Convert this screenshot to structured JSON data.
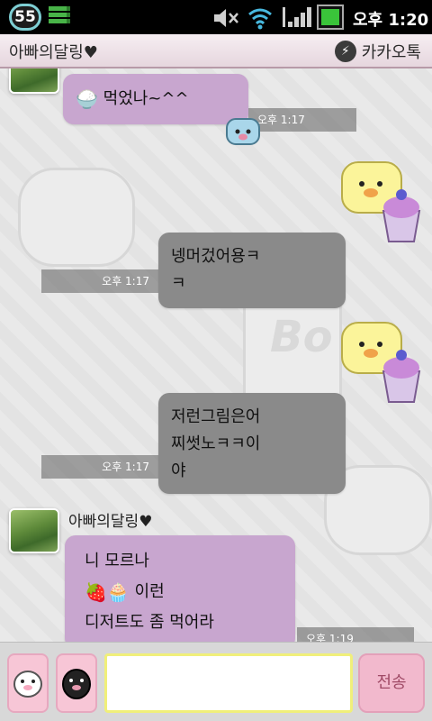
{
  "status_bar": {
    "notification_count": "55",
    "time": "오후 1:20",
    "icons": [
      "sd-card-icon",
      "mute-icon",
      "wifi-icon",
      "signal-icon",
      "battery-icon"
    ]
  },
  "header": {
    "title": "아빠의달링♥",
    "brand": "카카오톡",
    "brand_icon": "bolt-icon"
  },
  "messages": [
    {
      "side": "left",
      "text_lines": [
        "먹었나~^^"
      ],
      "leading_icon": "rice-bowl-icon",
      "time": "오후 1:17"
    },
    {
      "side": "right",
      "text_lines": [
        "넹머겄어용ㅋ",
        "ㅋ"
      ],
      "time": "오후 1:17"
    },
    {
      "side": "right",
      "text_lines": [
        "저런그림은어",
        "찌썻노ㅋㅋ이",
        "야"
      ],
      "time": "오후 1:17"
    },
    {
      "side": "left",
      "sender": "아빠의달링♥",
      "text_lines": [
        "니 모르나",
        "이런",
        "디저트도 좀 먹어라"
      ],
      "inline_icons": [
        "strawberry-icon",
        "cupcake-icon"
      ],
      "time": "오후 1:19"
    }
  ],
  "input_bar": {
    "message_placeholder": "",
    "send_label": "전송"
  },
  "colors": {
    "purple_bubble": "#c8a6cf",
    "gray_bubble": "#8a8a8a",
    "send_button": "#f2b9cd"
  }
}
